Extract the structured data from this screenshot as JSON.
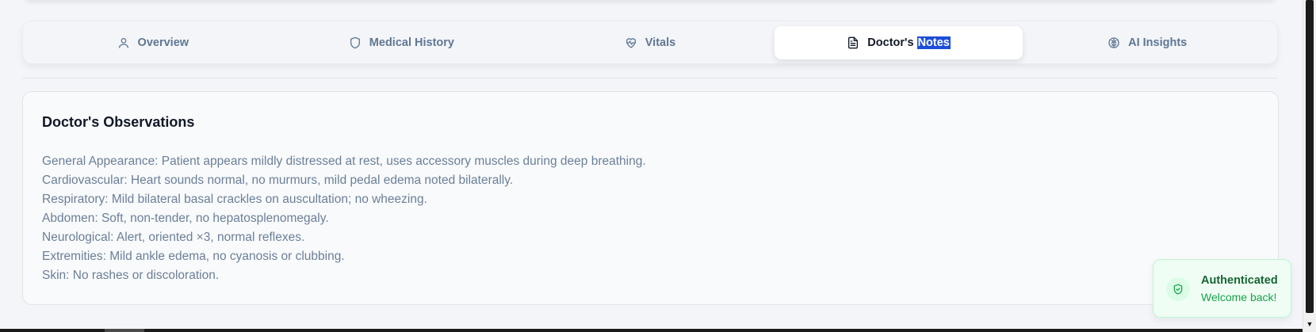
{
  "tabs": [
    {
      "label": "Overview",
      "icon": "user-icon"
    },
    {
      "label": "Medical History",
      "icon": "shield-icon"
    },
    {
      "label": "Vitals",
      "icon": "heart-pulse-icon"
    },
    {
      "label_prefix": "Doctor's ",
      "label_selected": "Notes",
      "icon": "file-text-icon",
      "active": true
    },
    {
      "label": "AI Insights",
      "icon": "brain-icon"
    }
  ],
  "observations": {
    "title": "Doctor's Observations",
    "lines": [
      "General Appearance: Patient appears mildly distressed at rest, uses accessory muscles during deep breathing.",
      "Cardiovascular: Heart sounds normal, no murmurs, mild pedal edema noted bilaterally.",
      "Respiratory: Mild bilateral basal crackles on auscultation; no wheezing.",
      "Abdomen: Soft, non-tender, no hepatosplenomegaly.",
      "Neurological: Alert, oriented ×3, normal reflexes.",
      "Extremities: Mild ankle edema, no cyanosis or clubbing.",
      "Skin: No rashes or discoloration."
    ]
  },
  "toast": {
    "title": "Authenticated",
    "message": "Welcome back!",
    "icon": "shield-check-icon"
  },
  "colors": {
    "accent": "#1d4ed8",
    "success": "#16a34a",
    "muted_text": "#6a7f99"
  }
}
